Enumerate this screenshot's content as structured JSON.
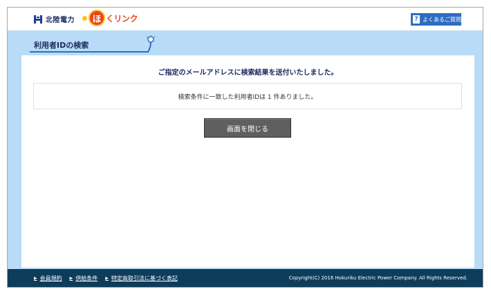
{
  "header": {
    "brand_name": "北陸電力",
    "service_logo_char": "ほ",
    "service_logo_rest": "くリンク",
    "faq_icon": "?",
    "faq_label": "よくあるご質問"
  },
  "page": {
    "title": "利用者IDの検索"
  },
  "main": {
    "message": "ご指定のメールアドレスに検索結果を送付いたしました。",
    "result": "検索条件に一致した利用者IDは 1 件ありました。",
    "close_button": "画面を閉じる"
  },
  "footer": {
    "links": [
      "会員規約",
      "供給条件",
      "特定商取引法に基づく表記"
    ],
    "copyright": "Copyright(C) 2016 Hokuriku Electric Power Company. All Rights Reserved."
  },
  "icons": {
    "brand": "hokuriku-logo-icon",
    "faq": "question-icon",
    "bulb": "lightbulb-icon",
    "link_arrow": "triangle-right-icon"
  },
  "colors": {
    "band": "#b8dcf7",
    "accent": "#2e6cc2",
    "footer": "#0e3d5c",
    "logo_orange": "#e7451c",
    "logo_yellow": "#f7c21e",
    "button": "#5f5f5f"
  }
}
